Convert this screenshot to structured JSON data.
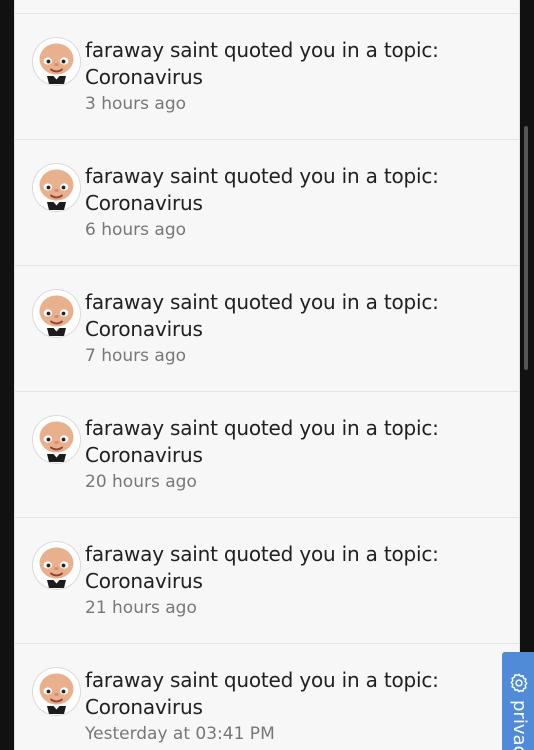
{
  "notifications": [
    {
      "actor": "faraway saint",
      "action": "quoted you in a topic:",
      "topic": "Coronavirus",
      "time": "3 hours ago"
    },
    {
      "actor": "faraway saint",
      "action": "quoted you in a topic:",
      "topic": "Coronavirus",
      "time": "6 hours ago"
    },
    {
      "actor": "faraway saint",
      "action": "quoted you in a topic:",
      "topic": "Coronavirus",
      "time": "7 hours ago"
    },
    {
      "actor": "faraway saint",
      "action": "quoted you in a topic:",
      "topic": "Coronavirus",
      "time": "20 hours ago"
    },
    {
      "actor": "faraway saint",
      "action": "quoted you in a topic:",
      "topic": "Coronavirus",
      "time": "21 hours ago"
    },
    {
      "actor": "faraway saint",
      "action": "quoted you in a topic:",
      "topic": "Coronavirus",
      "time": "Yesterday at 03:41 PM"
    }
  ],
  "privacy_tab": {
    "label": "privac",
    "icon": "gear-icon"
  },
  "colors": {
    "panel_background": "#f7f7f7",
    "page_background": "#111111",
    "text_primary": "#202020",
    "text_secondary": "#777777",
    "privacy_tab_background": "#4f8bd6"
  }
}
